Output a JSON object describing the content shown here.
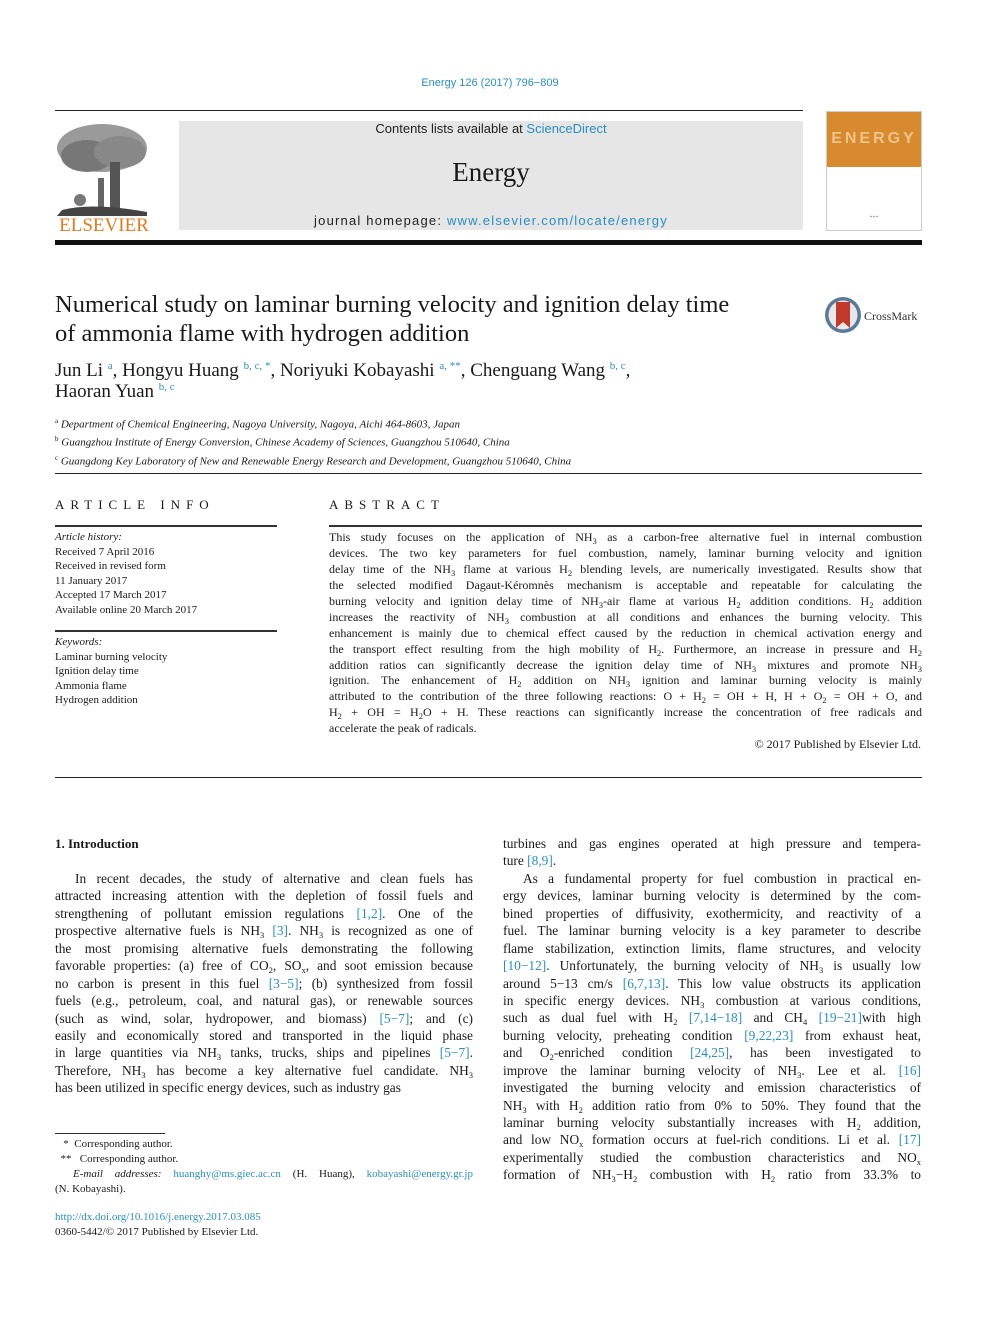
{
  "header": {
    "citation": "Energy 126 (2017) 796−809",
    "contents_prefix": "Contents lists available at ",
    "contents_link": "ScienceDirect",
    "journal_name": "Energy",
    "homepage_prefix": "journal homepage: ",
    "homepage_link": "www.elsevier.com/locate/energy",
    "publisher_logo": "ELSEVIER",
    "cover_word": "ENERGY",
    "crossmark_label": "CrossMark"
  },
  "article": {
    "title_lines": [
      "Numerical study on laminar burning velocity and ignition delay time",
      "of ammonia flame with hydrogen addition"
    ],
    "authors": [
      {
        "name": "Jun Li",
        "sup": "a",
        "sep": ", "
      },
      {
        "name": "Hongyu Huang",
        "sup": "b, c, *",
        "sep": ", "
      },
      {
        "name": "Noriyuki Kobayashi",
        "sup": "a, **",
        "sep": ", "
      },
      {
        "name": "Chenguang Wang",
        "sup": "b, c",
        "sep": ","
      },
      {
        "name": "Haoran Yuan",
        "sup": "b, c",
        "sep": ""
      }
    ],
    "affiliations": [
      {
        "key": "a",
        "text": "Department of Chemical Engineering, Nagoya University, Nagoya, Aichi 464-8603, Japan"
      },
      {
        "key": "b",
        "text": "Guangzhou Institute of Energy Conversion, Chinese Academy of Sciences, Guangzhou 510640, China"
      },
      {
        "key": "c",
        "text": "Guangdong Key Laboratory of New and Renewable Energy Research and Development, Guangzhou 510640, China"
      }
    ]
  },
  "article_info": {
    "heading": "ARTICLE INFO",
    "history_label": "Article history:",
    "history": [
      "Received 7 April 2016",
      "Received in revised form",
      "11 January 2017",
      "Accepted 17 March 2017",
      "Available online 20 March 2017"
    ],
    "keywords_label": "Keywords:",
    "keywords": [
      "Laminar burning velocity",
      "Ignition delay time",
      "Ammonia flame",
      "Hydrogen addition"
    ]
  },
  "abstract": {
    "heading": "ABSTRACT",
    "lines": [
      "This study focuses on the application of NH<sub>3</sub> as a carbon-free alternative fuel in internal combustion",
      "devices. The two key parameters for fuel combustion, namely, laminar burning velocity and ignition",
      "delay time of the NH<sub>3</sub> flame at various H<sub>2</sub> blending levels, are numerically investigated. Results show that",
      "the selected modified Dagaut-Kéromnès mechanism is acceptable and repeatable for calculating the",
      "burning velocity and ignition delay time of NH<sub>3</sub>-air flame at various H<sub>2</sub> addition conditions. H<sub>2</sub> addition",
      "increases the reactivity of NH<sub>3</sub> combustion at all conditions and enhances the burning velocity. This",
      "enhancement is mainly due to chemical effect caused by the reduction in chemical activation energy and",
      "the transport effect resulting from the high mobility of H<sub>2</sub>. Furthermore, an increase in pressure and H<sub>2</sub>",
      "addition ratios can significantly decrease the ignition delay time of NH<sub>3</sub> mixtures and promote NH<sub>3</sub>",
      "ignition. The enhancement of H<sub>2</sub> addition on NH<sub>3</sub> ignition and laminar burning velocity is mainly",
      "attributed to the contribution of the three following reactions: O + H<sub>2</sub> = OH + H, H + O<sub>2</sub> = OH + O, and",
      "H<sub>2</sub> + OH = H<sub>2</sub>O + H. These reactions can significantly increase the concentration of free radicals and",
      "accelerate the peak of radicals."
    ],
    "copyright": "© 2017 Published by Elsevier Ltd."
  },
  "body": {
    "section_heading": "1.  Introduction",
    "left_lines": [
      "In recent decades, the study of alternative and clean fuels has",
      "attracted increasing attention with the depletion of fossil fuels and",
      "strengthening of pollutant emission regulations <span class=\"link\">[1,2]</span>. One of the",
      "prospective alternative fuels is NH<sub>3</sub> <span class=\"link\">[3]</span>. NH<sub>3</sub> is recognized as one of",
      "the most promising alternative fuels demonstrating the following",
      "favorable properties: (a) free of CO<sub>2</sub>, SO<sub>x</sub>, and soot emission because",
      "no carbon is present in this fuel <span class=\"link\">[3−5]</span>; (b) synthesized from fossil",
      "fuels (e.g., petroleum, coal, and natural gas), or renewable sources",
      "(such as wind, solar, hydropower, and biomass) <span class=\"link\">[5−7]</span>; and (c)",
      "easily and economically stored and transported in the liquid phase",
      "in large quantities via NH<sub>3</sub> tanks, trucks, ships and pipelines <span class=\"link\">[5−7]</span>.",
      "Therefore, NH<sub>3</sub> has become a key alternative fuel candidate. NH<sub>3</sub>",
      "has been utilized in specific energy devices, such as industry gas"
    ],
    "right_lines": [
      "turbines and gas engines operated at high pressure and tempera-",
      "ture <span class=\"link\">[8,9]</span>.",
      "As a fundamental property for fuel combustion in practical en-",
      "ergy devices, laminar burning velocity is determined by the com-",
      "bined properties of diffusivity, exothermicity, and reactivity of a",
      "fuel. The laminar burning velocity is a key parameter to describe",
      "flame stabilization, extinction limits, flame structures, and velocity",
      "<span class=\"link\">[10−12]</span>. Unfortunately, the burning velocity of NH<sub>3</sub> is usually low",
      "around 5−13 cm/s <span class=\"link\">[6,7,13]</span>. This low value obstructs its application",
      "in specific energy devices. NH<sub>3</sub> combustion at various conditions,",
      "such as dual fuel with H<sub>2</sub> <span class=\"link\">[7,14−18]</span> and CH<sub>4</sub> <span class=\"link\">[19−21]</span>with high",
      "burning velocity, preheating condition <span class=\"link\">[9,22,23]</span> from exhaust heat,",
      "and O<sub>2</sub>-enriched condition <span class=\"link\">[24,25]</span>, has been investigated to",
      "improve the laminar burning velocity of NH<sub>3</sub>. Lee et al. <span class=\"link\">[16]</span>",
      "investigated the burning velocity and emission characteristics of",
      "NH<sub>3</sub> with H<sub>2</sub> addition ratio from 0% to 50%. They found that the",
      "laminar burning velocity substantially increases with H<sub>2</sub> addition,",
      "and low NO<sub>x</sub> formation occurs at fuel-rich conditions. Li et al. <span class=\"link\">[17]</span>",
      "experimentally studied the combustion characteristics and NO<sub>x</sub>",
      "formation of NH<sub>3</sub>−H<sub>2</sub> combustion with H<sub>2</sub> ratio from 33.3% to"
    ]
  },
  "footnotes": {
    "fn1_mark": "*",
    "fn1_text": "Corresponding author.",
    "fn2_mark": "**",
    "fn2_text": "Corresponding author.",
    "email_label": "E-mail addresses:",
    "email1": "huanghy@ms.giec.ac.cn",
    "email1_owner": "(H. Huang),",
    "email2": "kobayashi@energy.gr.jp",
    "email2_owner": "(N. Kobayashi).",
    "doi": "http://dx.doi.org/10.1016/j.energy.2017.03.085",
    "issn": "0360-5442/© 2017 Published by Elsevier Ltd."
  }
}
